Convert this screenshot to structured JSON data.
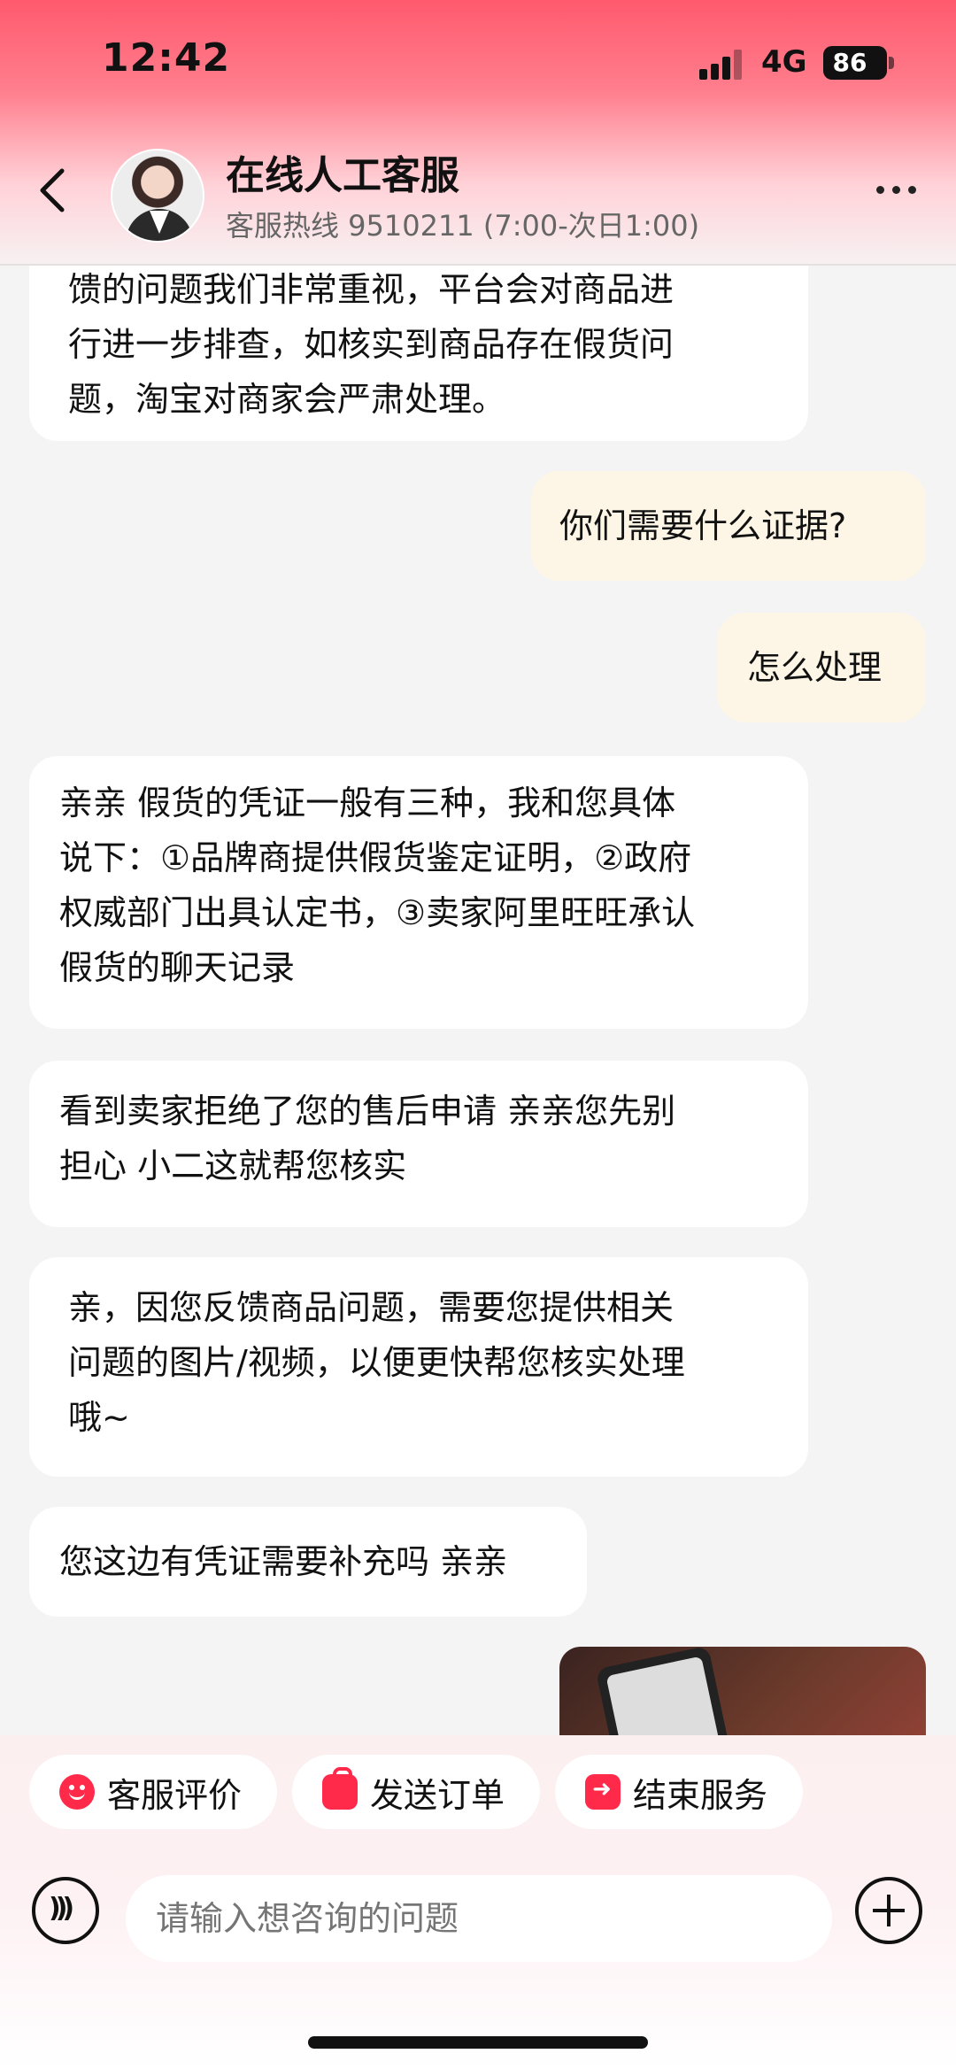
{
  "status_bar": {
    "time": "12:42",
    "network": "4G",
    "battery": "86"
  },
  "header": {
    "title": "在线人工客服",
    "subtitle": "客服热线 9510211 (7:00-次日1:00)"
  },
  "messages": [
    {
      "from": "agent",
      "lines": [
        "馈的问题我们非常重视，平台会对商品进",
        "行进一步排查，如核实到商品存在假货问",
        "题，淘宝对商家会严肃处理。"
      ]
    },
    {
      "from": "user",
      "text": "你们需要什么证据?"
    },
    {
      "from": "user",
      "text": "怎么处理"
    },
    {
      "from": "agent",
      "lines": [
        "亲亲 假货的凭证一般有三种，我和您具体",
        "说下：①品牌商提供假货鉴定证明，②政府",
        "权威部门出具认定书，③卖家阿里旺旺承认",
        "假货的聊天记录"
      ]
    },
    {
      "from": "agent",
      "lines": [
        "看到卖家拒绝了您的售后申请  亲亲您先别",
        "担心 小二这就帮您核实"
      ]
    },
    {
      "from": "agent",
      "lines": [
        "亲，因您反馈商品问题，需要您提供相关",
        "问题的图片/视频，以便更快帮您核实处理",
        "哦~"
      ]
    },
    {
      "from": "agent",
      "text": "您这边有凭证需要补充吗 亲亲"
    }
  ],
  "quick_actions": [
    "客服评价",
    "发送订单",
    "结束服务"
  ],
  "composer": {
    "placeholder": "请输入想咨询的问题"
  }
}
